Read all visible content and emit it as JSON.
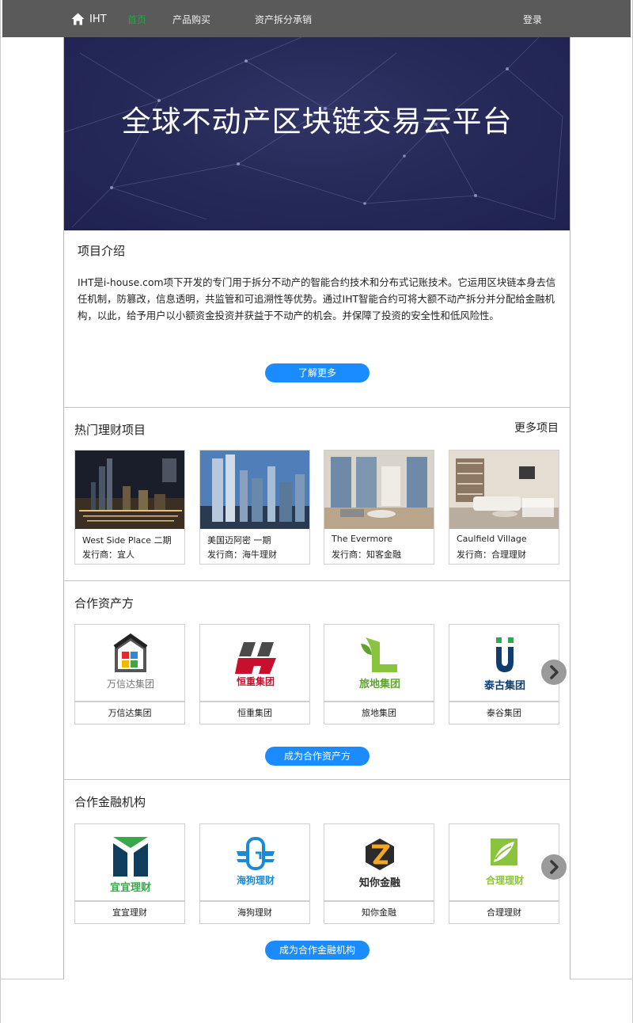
{
  "nav": {
    "brand": "IHT",
    "items": [
      {
        "label": "首页",
        "active": true
      },
      {
        "label": "产品购买",
        "active": false
      },
      {
        "label": "资产拆分承销",
        "active": false
      }
    ],
    "login": "登录"
  },
  "hero": {
    "title": "全球不动产区块链交易云平台"
  },
  "intro": {
    "title": "项目介绍",
    "body": "IHT是i-house.com项下开发的专门用于拆分不动产的智能合约技术和分布式记账技术。它运用区块链本身去信任机制，防篡改，信息透明，共监管和可追溯性等优势。通过IHT智能合约可将大额不动产拆分并分配给金融机构，以此，给予用户以小额资金投资并获益于不动产的机会。并保障了投资的安全性和低风险性。",
    "button": "了解更多"
  },
  "hot": {
    "title": "热门理财项目",
    "more": "更多项目",
    "items": [
      {
        "name": "West Side Place 二期",
        "issuer": "发行商：宜人"
      },
      {
        "name": "美国迈阿密 一期",
        "issuer": "发行商：海牛理财"
      },
      {
        "name": "The Evermore",
        "issuer": "发行商：知客金融"
      },
      {
        "name": "Caulfield Village",
        "issuer": "发行商：合理理财"
      }
    ]
  },
  "asset_partners": {
    "title": "合作资产方",
    "items": [
      {
        "name": "万信达集团",
        "logo_text": "万信达集团"
      },
      {
        "name": "恒重集团",
        "logo_text": "恒重集团"
      },
      {
        "name": "旅地集团",
        "logo_text": "旅地集团"
      },
      {
        "name": "泰谷集团",
        "logo_text": "泰古集团"
      }
    ],
    "button": "成为合作资产方"
  },
  "finance_partners": {
    "title": "合作金融机构",
    "items": [
      {
        "name": "宜宜理财",
        "logo_text": "宜宜理财"
      },
      {
        "name": "海狗理财",
        "logo_text": "海狗理财"
      },
      {
        "name": "知你金融",
        "logo_text": "知你金融"
      },
      {
        "name": "合理理财",
        "logo_text": "合理理财"
      }
    ],
    "button": "成为合作金融机构"
  },
  "colors": {
    "nav_bg": "#5a5a5a",
    "nav_active": "#21a845",
    "accent_button": "#1a8cff",
    "hero_bg": "#262a58"
  },
  "icons": {
    "brand": "home-icon",
    "carousel_next": "chevron-right-icon"
  }
}
